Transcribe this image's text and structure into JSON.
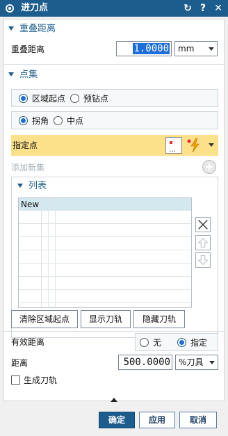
{
  "window": {
    "title": "进刀点",
    "reset_glyph": "↻",
    "help_glyph": "?",
    "close_glyph": "✕",
    "icon": "gear-tool-icon"
  },
  "overlap": {
    "header": "重叠距离",
    "label": "重叠距离",
    "value": "1.0000",
    "unit": "mm"
  },
  "point_set": {
    "header": "点集",
    "mode_options": [
      {
        "label": "区域起点",
        "selected": true
      },
      {
        "label": "预钻点",
        "selected": false
      }
    ],
    "corner_options": [
      {
        "label": "拐角",
        "selected": true
      },
      {
        "label": "中点",
        "selected": false
      }
    ],
    "specify_label": "指定点",
    "add_new_label": "添加新集"
  },
  "list": {
    "header": "列表",
    "rows": [
      "New",
      "",
      "",
      "",
      "",
      "",
      "",
      ""
    ]
  },
  "buttons": {
    "clear": "清除区域起点",
    "show": "显示刀轨",
    "hide": "隐藏刀轨"
  },
  "effective_distance": {
    "label": "有效距离",
    "options": [
      {
        "label": "无",
        "selected": false
      },
      {
        "label": "指定",
        "selected": true
      }
    ]
  },
  "distance": {
    "label": "距离",
    "value": "500.0000",
    "unit": "%刀具"
  },
  "generate_toolpath": {
    "label": "生成刀轨",
    "checked": false
  },
  "footer": {
    "ok": "确定",
    "apply": "应用",
    "cancel": "取消"
  },
  "colors": {
    "accent": "#1d5d8e",
    "highlight_row": "#fde08a",
    "selection": "#1d6ed8"
  }
}
